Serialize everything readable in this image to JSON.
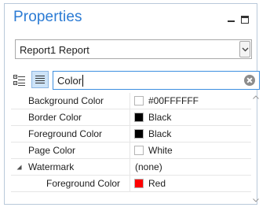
{
  "panel": {
    "title": "Properties",
    "controls": [
      "minimize-icon",
      "maximize-icon"
    ]
  },
  "selector": {
    "value": "Report1  Report"
  },
  "toolbar": {
    "categorized_icon": "categorized-view-icon",
    "alphabetical_icon": "alphabetical-view-icon"
  },
  "search": {
    "value": "Color"
  },
  "properties": [
    {
      "name": "Background Color",
      "value": "#00FFFFFF",
      "swatch": "#ffffff",
      "indent": 0
    },
    {
      "name": "Border Color",
      "value": "Black",
      "swatch": "#000000",
      "indent": 0
    },
    {
      "name": "Foreground Color",
      "value": "Black",
      "swatch": "#000000",
      "indent": 0
    },
    {
      "name": "Page Color",
      "value": "White",
      "swatch": "#ffffff",
      "indent": 0
    },
    {
      "name": "Watermark",
      "value": "(none)",
      "swatch": null,
      "indent": 0,
      "expandable": true,
      "expanded": true
    },
    {
      "name": "Foreground Color",
      "value": "Red",
      "swatch": "#ff0000",
      "indent": 1
    }
  ],
  "colors": {
    "accent": "#2b7bd4",
    "search_border": "#3d8fe0"
  }
}
